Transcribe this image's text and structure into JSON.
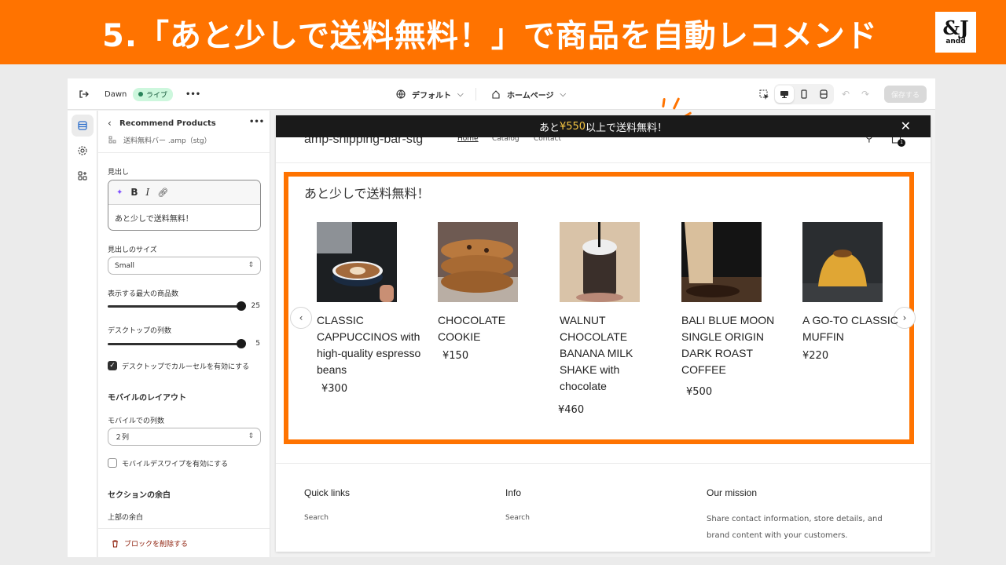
{
  "banner": {
    "title": "5.「あと少しで送料無料！」で商品を自動レコメンド",
    "logo_mark": "&J",
    "logo_text": "andd",
    "accent_color": "#ff7300"
  },
  "topbar": {
    "exit_icon": "exit-icon",
    "theme_name": "Dawn",
    "status_badge": "ライブ",
    "more_icon": "•••",
    "language_select": "デフォルト",
    "page_select": "ホームページ",
    "save_label": "保存する"
  },
  "panel": {
    "title": "Recommend Products",
    "subtitle": "送料無料バー .amp（stg）",
    "heading_label": "見出し",
    "heading_value": "あと少しで送料無料！",
    "heading_size_label": "見出しのサイズ",
    "heading_size_value": "Small",
    "max_products_label": "表示する最大の商品数",
    "max_products_value": "25",
    "desktop_columns_label": "デスクトップの列数",
    "desktop_columns_value": "5",
    "desktop_carousel_label": "デスクトップでカルーセルを有効にする",
    "desktop_carousel_checked": true,
    "mobile_layout_heading": "モバイルのレイアウト",
    "mobile_columns_label": "モバイルでの列数",
    "mobile_columns_value": "２列",
    "mobile_swipe_label": "モバイルデスワイプを有効にする",
    "mobile_swipe_checked": false,
    "section_padding_heading": "セクションの余白",
    "top_padding_label": "上部の余白",
    "delete_block_label": "ブロックを削除する"
  },
  "preview": {
    "announcement": {
      "prefix": "あと",
      "amount": "¥550",
      "suffix": "以上で送料無料！",
      "amount_color": "#f5c542"
    },
    "store_name": "amp-shipping-bar-stg",
    "nav": [
      "Home",
      "Catalog",
      "Contact"
    ],
    "cart_count": "1",
    "recommend_title": "あと少しで送料無料！",
    "products": [
      {
        "name": "CLASSIC CAPPUCCINOS with high-quality espresso beans",
        "price": "¥300",
        "image": "cappuccino-image"
      },
      {
        "name": "CHOCOLATE COOKIE",
        "price": "¥150",
        "image": "cookie-image"
      },
      {
        "name": "WALNUT CHOCOLATE BANANA MILK SHAKE with chocolate",
        "price": "¥460",
        "image": "milkshake-image"
      },
      {
        "name": "BALI BLUE MOON SINGLE ORIGIN DARK ROAST COFFEE",
        "price": "¥500",
        "image": "coffee-bag-image"
      },
      {
        "name": "A GO-TO CLASSIC MUFFIN",
        "price": "¥220",
        "image": "muffin-image"
      }
    ],
    "footer": {
      "quick_links_heading": "Quick links",
      "quick_links_item": "Search",
      "info_heading": "Info",
      "info_item": "Search",
      "mission_heading": "Our mission",
      "mission_text": "Share contact information, store details, and brand content with your customers."
    }
  }
}
